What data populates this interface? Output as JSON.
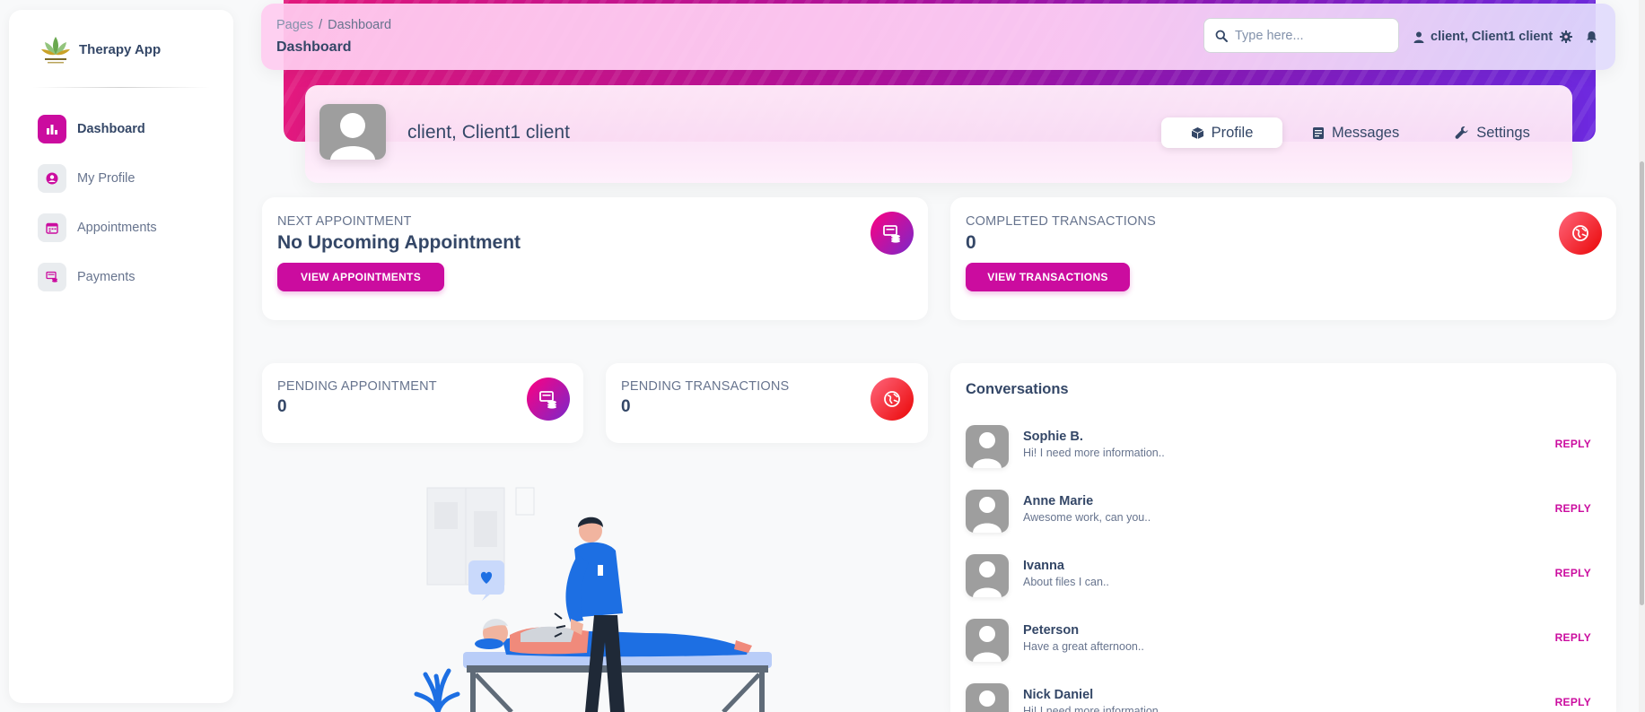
{
  "brand": {
    "name": "Therapy App"
  },
  "sidebar": {
    "items": [
      {
        "label": "Dashboard",
        "icon": "bar-chart-icon",
        "active": true
      },
      {
        "label": "My Profile",
        "icon": "user-circle-icon",
        "active": false
      },
      {
        "label": "Appointments",
        "icon": "calendar-icon",
        "active": false
      },
      {
        "label": "Payments",
        "icon": "payment-icon",
        "active": false
      }
    ]
  },
  "header": {
    "breadcrumb_root": "Pages",
    "breadcrumb_sep": "/",
    "breadcrumb_current": "Dashboard",
    "title": "Dashboard",
    "search_placeholder": "Type here...",
    "user_name": "client, Client1 client"
  },
  "profile": {
    "name": "client, Client1 client",
    "tabs": [
      {
        "label": "Profile",
        "icon": "cube-icon"
      },
      {
        "label": "Messages",
        "icon": "document-icon"
      },
      {
        "label": "Settings",
        "icon": "wrench-icon"
      }
    ]
  },
  "cards": {
    "next_appointment": {
      "label": "NEXT APPOINTMENT",
      "value": "No Upcoming Appointment",
      "button": "VIEW APPOINTMENTS"
    },
    "completed_transactions": {
      "label": "COMPLETED TRANSACTIONS",
      "value": "0",
      "button": "VIEW TRANSACTIONS"
    },
    "pending_appointment": {
      "label": "PENDING APPOINTMENT",
      "value": "0"
    },
    "pending_transactions": {
      "label": "PENDING TRANSACTIONS",
      "value": "0"
    }
  },
  "conversations": {
    "title": "Conversations",
    "reply_label": "REPLY",
    "items": [
      {
        "name": "Sophie B.",
        "message": "Hi! I need more information.."
      },
      {
        "name": "Anne Marie",
        "message": "Awesome work, can you.."
      },
      {
        "name": "Ivanna",
        "message": "About files I can.."
      },
      {
        "name": "Peterson",
        "message": "Have a great afternoon.."
      },
      {
        "name": "Nick Daniel",
        "message": "Hi! I need more information.."
      }
    ]
  },
  "colors": {
    "accent": "#cb0c9f",
    "text": "#344767",
    "muted": "#67748e"
  }
}
